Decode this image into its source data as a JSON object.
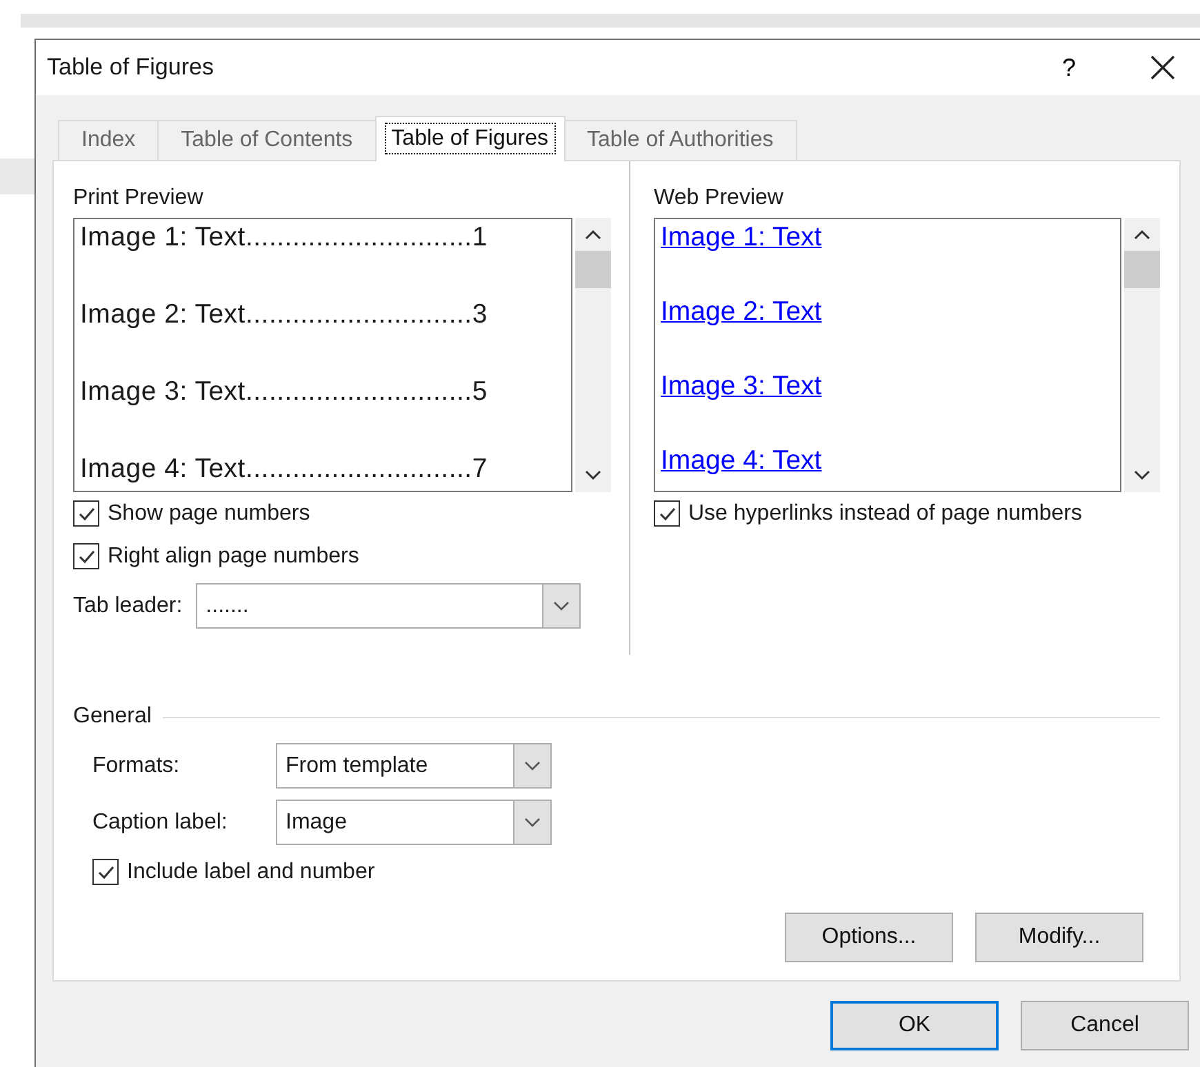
{
  "window": {
    "title": "Table of Figures",
    "help": "?"
  },
  "tabs": [
    {
      "label": "Index",
      "selected": false
    },
    {
      "label": "Table of Contents",
      "selected": false
    },
    {
      "label": "Table of Figures",
      "selected": true
    },
    {
      "label": "Table of Authorities",
      "selected": false
    }
  ],
  "print_preview": {
    "label": "Print Preview",
    "entries": [
      "Image 1: Text.............................1",
      "Image 2: Text.............................3",
      "Image 3: Text.............................5",
      "Image 4: Text.............................7"
    ]
  },
  "print_options": [
    {
      "label": "Show page numbers",
      "checked": true
    },
    {
      "label": "Right align page numbers",
      "checked": true
    }
  ],
  "tab_leader": {
    "label": "Tab leader:",
    "value": "......."
  },
  "web_preview": {
    "label": "Web Preview",
    "links": [
      "Image 1: Text",
      "Image 2: Text",
      "Image 3: Text",
      "Image 4: Text"
    ]
  },
  "web_options": [
    {
      "label": "Use hyperlinks instead of page numbers",
      "checked": true
    }
  ],
  "general": {
    "title": "General",
    "fields": [
      {
        "label": "Formats:",
        "value": "From template"
      },
      {
        "label": "Caption label:",
        "value": "Image"
      }
    ],
    "options": [
      {
        "label": "Include label and number",
        "checked": true
      }
    ]
  },
  "panel_buttons": [
    "Options...",
    "Modify..."
  ],
  "dialog_buttons": [
    {
      "label": "OK",
      "default": true
    },
    {
      "label": "Cancel",
      "default": false
    }
  ]
}
